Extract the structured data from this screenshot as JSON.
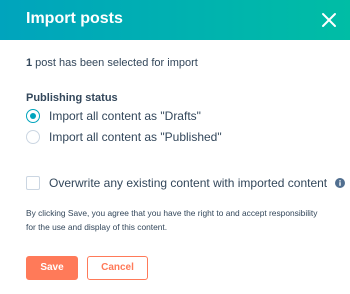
{
  "header": {
    "title": "Import posts",
    "close_icon": "close-icon",
    "gradient_start": "#00a4bd",
    "gradient_end": "#00bda5"
  },
  "selection": {
    "count": "1",
    "text": " post has been selected for import"
  },
  "publishing": {
    "label": "Publishing status",
    "options": [
      {
        "label": "Import all content as \"Drafts\"",
        "checked": true
      },
      {
        "label": "Import all content as \"Published\"",
        "checked": false
      }
    ]
  },
  "overwrite": {
    "label": "Overwrite any existing content with imported content",
    "checked": false,
    "info_icon": "info-icon"
  },
  "disclaimer": "By clicking Save, you agree that you have the right to and accept responsibility for the use and display of this content.",
  "buttons": {
    "save": "Save",
    "cancel": "Cancel",
    "accent": "#ff7a59"
  }
}
